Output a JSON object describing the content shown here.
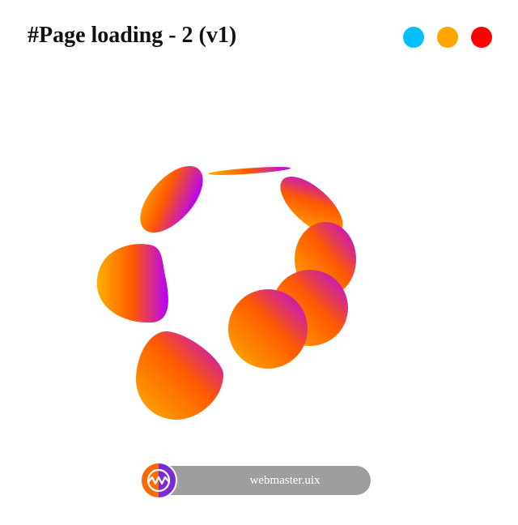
{
  "header": {
    "title": "#Page loading - 2 (v1)"
  },
  "theme_switcher": {
    "dots": [
      {
        "name": "blue",
        "color": "#00bfff"
      },
      {
        "name": "orange",
        "color": "#ffa500"
      },
      {
        "name": "red",
        "color": "#ff0000"
      }
    ]
  },
  "loader": {
    "gradient_colors": [
      "#ffb000",
      "#ff5a00",
      "#b400ff"
    ]
  },
  "brand": {
    "text": "webmaster.uix",
    "logo_initials": "wm"
  }
}
